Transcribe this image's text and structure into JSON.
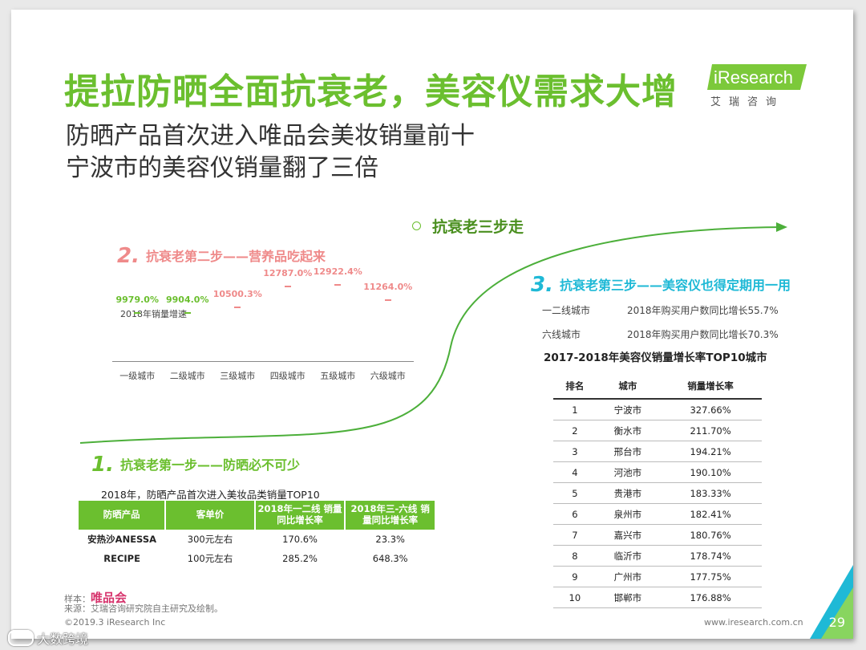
{
  "title": "提拉防晒全面抗衰老，美容仪需求大增",
  "subtitle_lines": [
    "防晒产品首次进入唯品会美妆销量前十",
    "宁波市的美容仪销量翻了三倍"
  ],
  "logo": {
    "wordmark": "iResearch",
    "cn": "艾瑞咨询"
  },
  "center_label": "抗衰老三步走",
  "step1": {
    "num": "1.",
    "head": "抗衰老第一步——防晒必不可少",
    "table_caption": "2018年，防晒产品首次进入美妆品类销量TOP10",
    "headers": [
      "防晒产品",
      "客单价",
      "2018年一二线 销量同比增长率",
      "2018年三-六线 销量同比增长率"
    ],
    "rows": [
      [
        "安热沙ANESSA",
        "300元左右",
        "170.6%",
        "23.3%"
      ],
      [
        "RECIPE",
        "100元左右",
        "285.2%",
        "648.3%"
      ]
    ]
  },
  "step2": {
    "num": "2.",
    "head": "抗衰老第二步——营养品吃起来",
    "chart_label": "2018年销量增速"
  },
  "chart_data": {
    "type": "bar",
    "title": "2018年销量增速",
    "categories": [
      "一级城市",
      "二级城市",
      "三级城市",
      "四级城市",
      "五级城市",
      "六级城市"
    ],
    "values": [
      9979.0,
      9904.0,
      10500.3,
      12787.0,
      12922.4,
      11264.0
    ],
    "value_labels": [
      "9979.0%",
      "9904.0%",
      "10500.3%",
      "12787.0%",
      "12922.4%",
      "11264.0%"
    ],
    "colors": [
      "#6bbf2f",
      "#6bbf2f",
      "#ef8a8a",
      "#ef8a8a",
      "#ef8a8a",
      "#ef8a8a"
    ],
    "ylim": [
      9000,
      13500
    ]
  },
  "step3": {
    "num": "3.",
    "head": "抗衰老第三步——美容仪也得定期用一用",
    "stats": [
      {
        "tier": "一二线城市",
        "text": "2018年购买用户数同比增长55.7%"
      },
      {
        "tier": "六线城市",
        "text": "2018年购买用户数同比增长70.3%"
      }
    ],
    "table_title": "2017-2018年美容仪销量增长率TOP10城市",
    "headers": [
      "排名",
      "城市",
      "销量增长率"
    ],
    "rows": [
      [
        "1",
        "宁波市",
        "327.66%"
      ],
      [
        "2",
        "衡水市",
        "211.70%"
      ],
      [
        "3",
        "邢台市",
        "194.21%"
      ],
      [
        "4",
        "河池市",
        "190.10%"
      ],
      [
        "5",
        "贵港市",
        "183.33%"
      ],
      [
        "6",
        "泉州市",
        "182.41%"
      ],
      [
        "7",
        "嘉兴市",
        "180.76%"
      ],
      [
        "8",
        "临沂市",
        "178.74%"
      ],
      [
        "9",
        "广州市",
        "177.75%"
      ],
      [
        "10",
        "邯郸市",
        "176.88%"
      ]
    ]
  },
  "sample": {
    "label": "样本：",
    "value": "唯品会"
  },
  "source": "来源：艾瑞咨询研究院自主研究及绘制。",
  "copyright": "©2019.3 iResearch Inc",
  "website": "www.iresearch.com.cn",
  "page_number": "29",
  "watermark": "大数跨境",
  "colors": {
    "green": "#6bbf2f",
    "pink": "#ef8a8a",
    "cyan": "#1fb9d6"
  }
}
